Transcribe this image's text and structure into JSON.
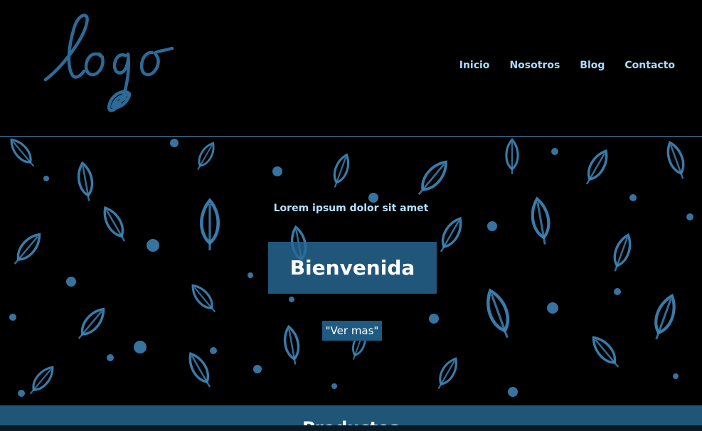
{
  "logo": {
    "text": "logo",
    "icon": "leaf-logo-icon",
    "color": "#2c6a97"
  },
  "nav": {
    "items": [
      {
        "label": "Inicio"
      },
      {
        "label": "Nosotros"
      },
      {
        "label": "Blog"
      },
      {
        "label": "Contacto"
      }
    ]
  },
  "hero": {
    "subtitle": "Lorem ipsum dolor sit amet",
    "title": "Bienvenida",
    "button_label": "\"Ver mas\"",
    "pattern_icon": "leaf-pattern",
    "pattern_color": "#3f88bb"
  },
  "products": {
    "title": "Productos"
  }
}
